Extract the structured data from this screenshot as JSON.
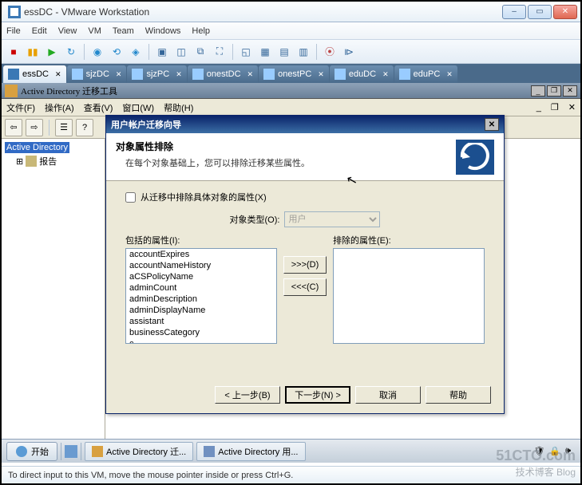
{
  "window": {
    "title": "essDC - VMware Workstation"
  },
  "menu": {
    "file": "File",
    "edit": "Edit",
    "view": "View",
    "vm": "VM",
    "team": "Team",
    "windows": "Windows",
    "help": "Help"
  },
  "tabs": [
    {
      "label": "essDC",
      "active": true
    },
    {
      "label": "sjzDC",
      "active": false
    },
    {
      "label": "sjzPC",
      "active": false
    },
    {
      "label": "onestDC",
      "active": false
    },
    {
      "label": "onestPC",
      "active": false
    },
    {
      "label": "eduDC",
      "active": false
    },
    {
      "label": "eduPC",
      "active": false
    }
  ],
  "mmc": {
    "title": "Active Directory 迁移工具",
    "menu": {
      "file": "文件(F)",
      "action": "操作(A)",
      "view": "查看(V)",
      "window": "窗口(W)",
      "help": "帮助(H)"
    },
    "tree": {
      "root": "Active Directory",
      "child": "报告"
    }
  },
  "dialog": {
    "title": "用户帐户迁移向导",
    "heading": "对象属性排除",
    "subheading": "在每个对象基础上，您可以排除迁移某些属性。",
    "checkbox": "从迁移中排除具体对象的属性(X)",
    "type_label": "对象类型(O):",
    "type_value": "用户",
    "include_label": "包括的属性(I):",
    "exclude_label": "排除的属性(E):",
    "include_items": [
      "accountExpires",
      "accountNameHistory",
      "aCSPolicyName",
      "adminCount",
      "adminDescription",
      "adminDisplayName",
      "assistant",
      "businessCategory",
      "c"
    ],
    "btn_add": ">>>(D)",
    "btn_remove": "<<<(C)",
    "btn_back": "< 上一步(B)",
    "btn_next": "下一步(N) >",
    "btn_cancel": "取消",
    "btn_help": "帮助"
  },
  "taskbar": {
    "start": "开始",
    "task1": "Active Directory 迁...",
    "task2": "Active Directory 用..."
  },
  "status": "To direct input to this VM, move the mouse pointer inside or press Ctrl+G.",
  "watermark1": "51CTO.com",
  "watermark2": "技术博客  Blog"
}
